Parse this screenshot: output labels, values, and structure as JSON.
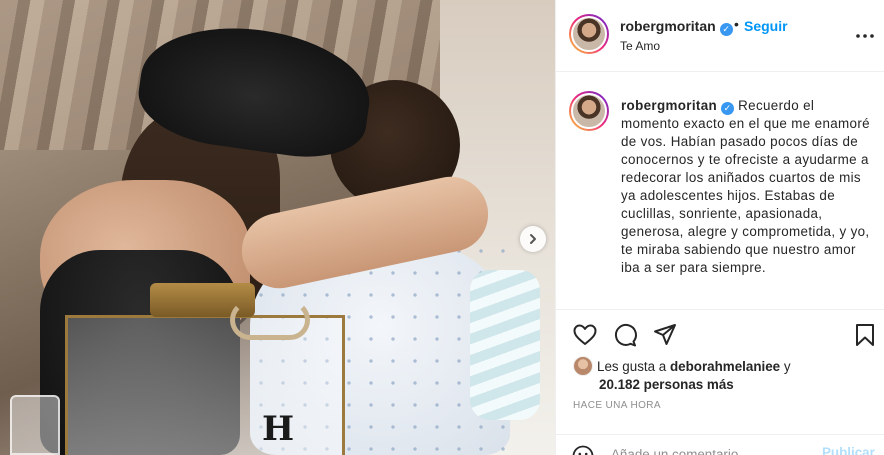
{
  "post": {
    "username": "robergmoritan",
    "verified_mark": "✓",
    "separator": "•",
    "follow_label": "Seguir",
    "location": "Te Amo",
    "more_icon": "more-options-icon",
    "caption": "Recuerdo el momento exacto en el que me enamoré de vos. Habían pasado pocos días de conocernos y te ofreciste a ayudarme a redecorar los aniñados cuartos de mis ya adolescentes hijos. Estabas de cuclillas, sonriente, apasionada, generosa, alegre y comprometida, y yo, te miraba sabiendo que nuestro amor iba a ser para siempre.",
    "photo_logo": "H",
    "next_icon": "chevron-right-icon"
  },
  "actions": {
    "like_icon": "heart-icon",
    "comment_icon": "comment-icon",
    "share_icon": "paper-plane-icon",
    "save_icon": "bookmark-icon"
  },
  "likes": {
    "prefix": "Les gusta a ",
    "user": "deborahmelaniee",
    "connector": " y",
    "others": "20.182 personas más"
  },
  "timestamp": "HACE UNA HORA",
  "comment": {
    "placeholder": "Añade un comentario...",
    "publish_label": "Publicar",
    "emoji_icon": "smiley-icon"
  },
  "colors": {
    "accent": "#0095f6",
    "verified": "#3897f0",
    "publish_disabled": "#b2dffc",
    "muted": "#8e8e8e",
    "text": "#262626"
  }
}
